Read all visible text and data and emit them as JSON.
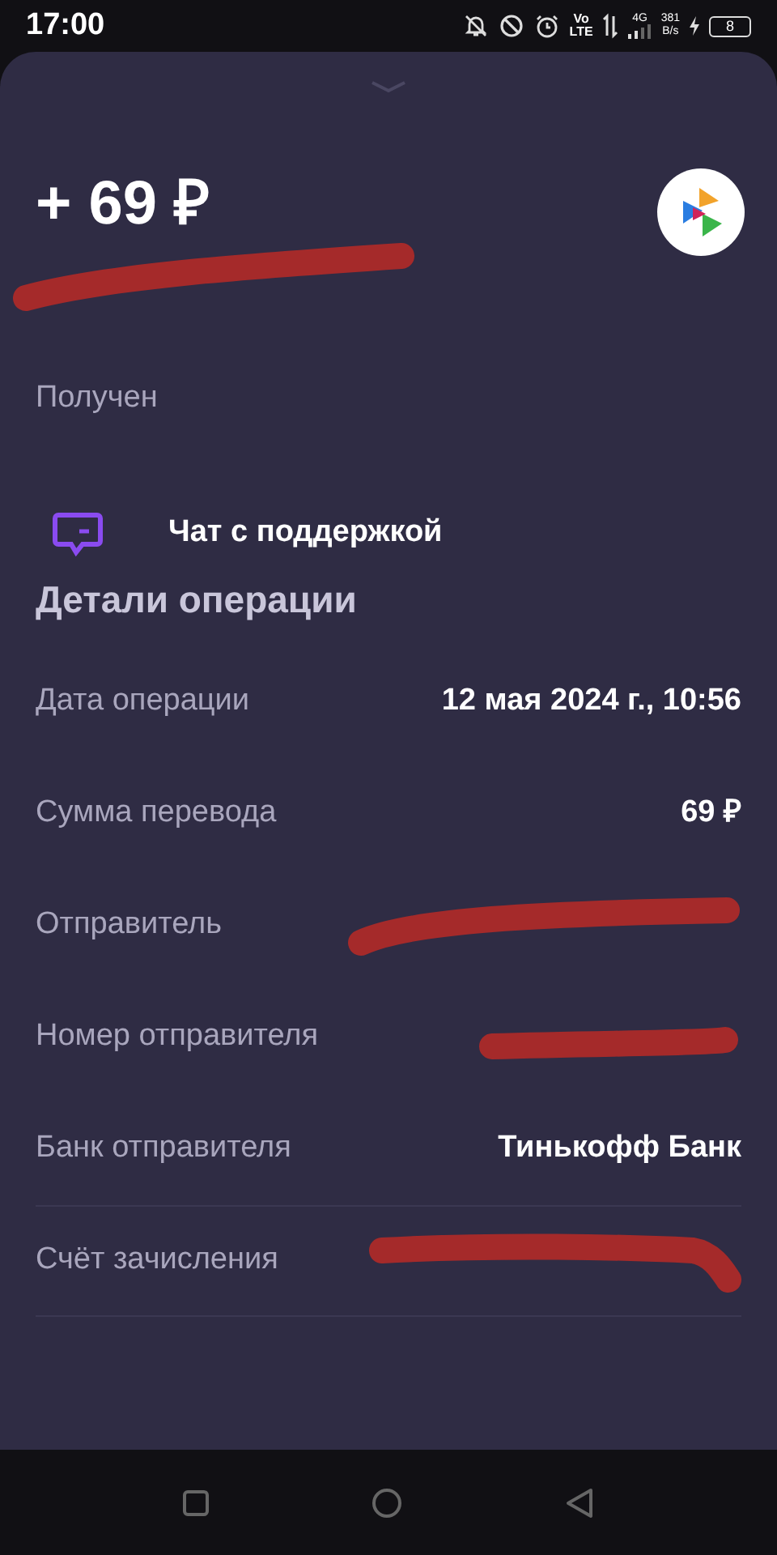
{
  "status_bar": {
    "time": "17:00",
    "volte_top": "Vo",
    "volte_bottom": "LTE",
    "network": "4G",
    "speed": "381",
    "speed_unit": "B/s",
    "battery": "8"
  },
  "header": {
    "amount": "+ 69 ₽",
    "name_redacted": true,
    "status": "Получен"
  },
  "support": {
    "label": "Чат с поддержкой"
  },
  "details": {
    "title": "Детали операции",
    "rows": [
      {
        "label": "Дата операции",
        "value": "12 мая 2024 г., 10:56",
        "redacted": false
      },
      {
        "label": "Сумма перевода",
        "value": "69 ₽",
        "redacted": false
      },
      {
        "label": "Отправитель",
        "redacted": true
      },
      {
        "label": "Номер отправителя",
        "redacted": true
      },
      {
        "label": "Банк отправителя",
        "value": "Тинькофф Банк",
        "redacted": false
      },
      {
        "label": "Счёт зачисления",
        "redacted": true
      }
    ]
  }
}
